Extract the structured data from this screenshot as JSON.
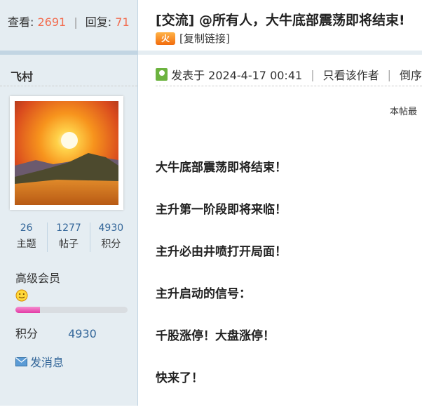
{
  "stats": {
    "views_label": "查看:",
    "views": "2691",
    "replies_label": "回复:",
    "replies": "71",
    "separator": "|"
  },
  "thread": {
    "title": "[交流] @所有人，大牛底部震荡即将结束!",
    "hot_badge": "火",
    "copy_link": "[复制链接]"
  },
  "author": {
    "name": "飞村",
    "topics": "26",
    "topics_label": "主题",
    "posts": "1277",
    "posts_label": "帖子",
    "credits": "4930",
    "credits_label": "积分",
    "group": "高级会员",
    "level_progress": 0.22,
    "credits_row_label": "积分",
    "credits_row_value": "4930",
    "send_message": "发消息"
  },
  "post": {
    "posted_on": "发表于 2024-4-17 00:41",
    "only_author": "只看该作者",
    "reverse": "倒序",
    "separator": "|",
    "edit_note": "本帖最",
    "lines": [
      "大牛底部震荡即将结束！",
      "主升第一阶段即将来临！",
      "主升必由井喷打开局面！",
      "主升启动的信号：",
      "千股涨停！大盘涨停！",
      "快来了！"
    ]
  },
  "colors": {
    "sidebar_bg": "#e5edf2",
    "accent_number": "#f26c4f",
    "link_blue": "#336699",
    "progress_pink": "#e23aa5"
  }
}
